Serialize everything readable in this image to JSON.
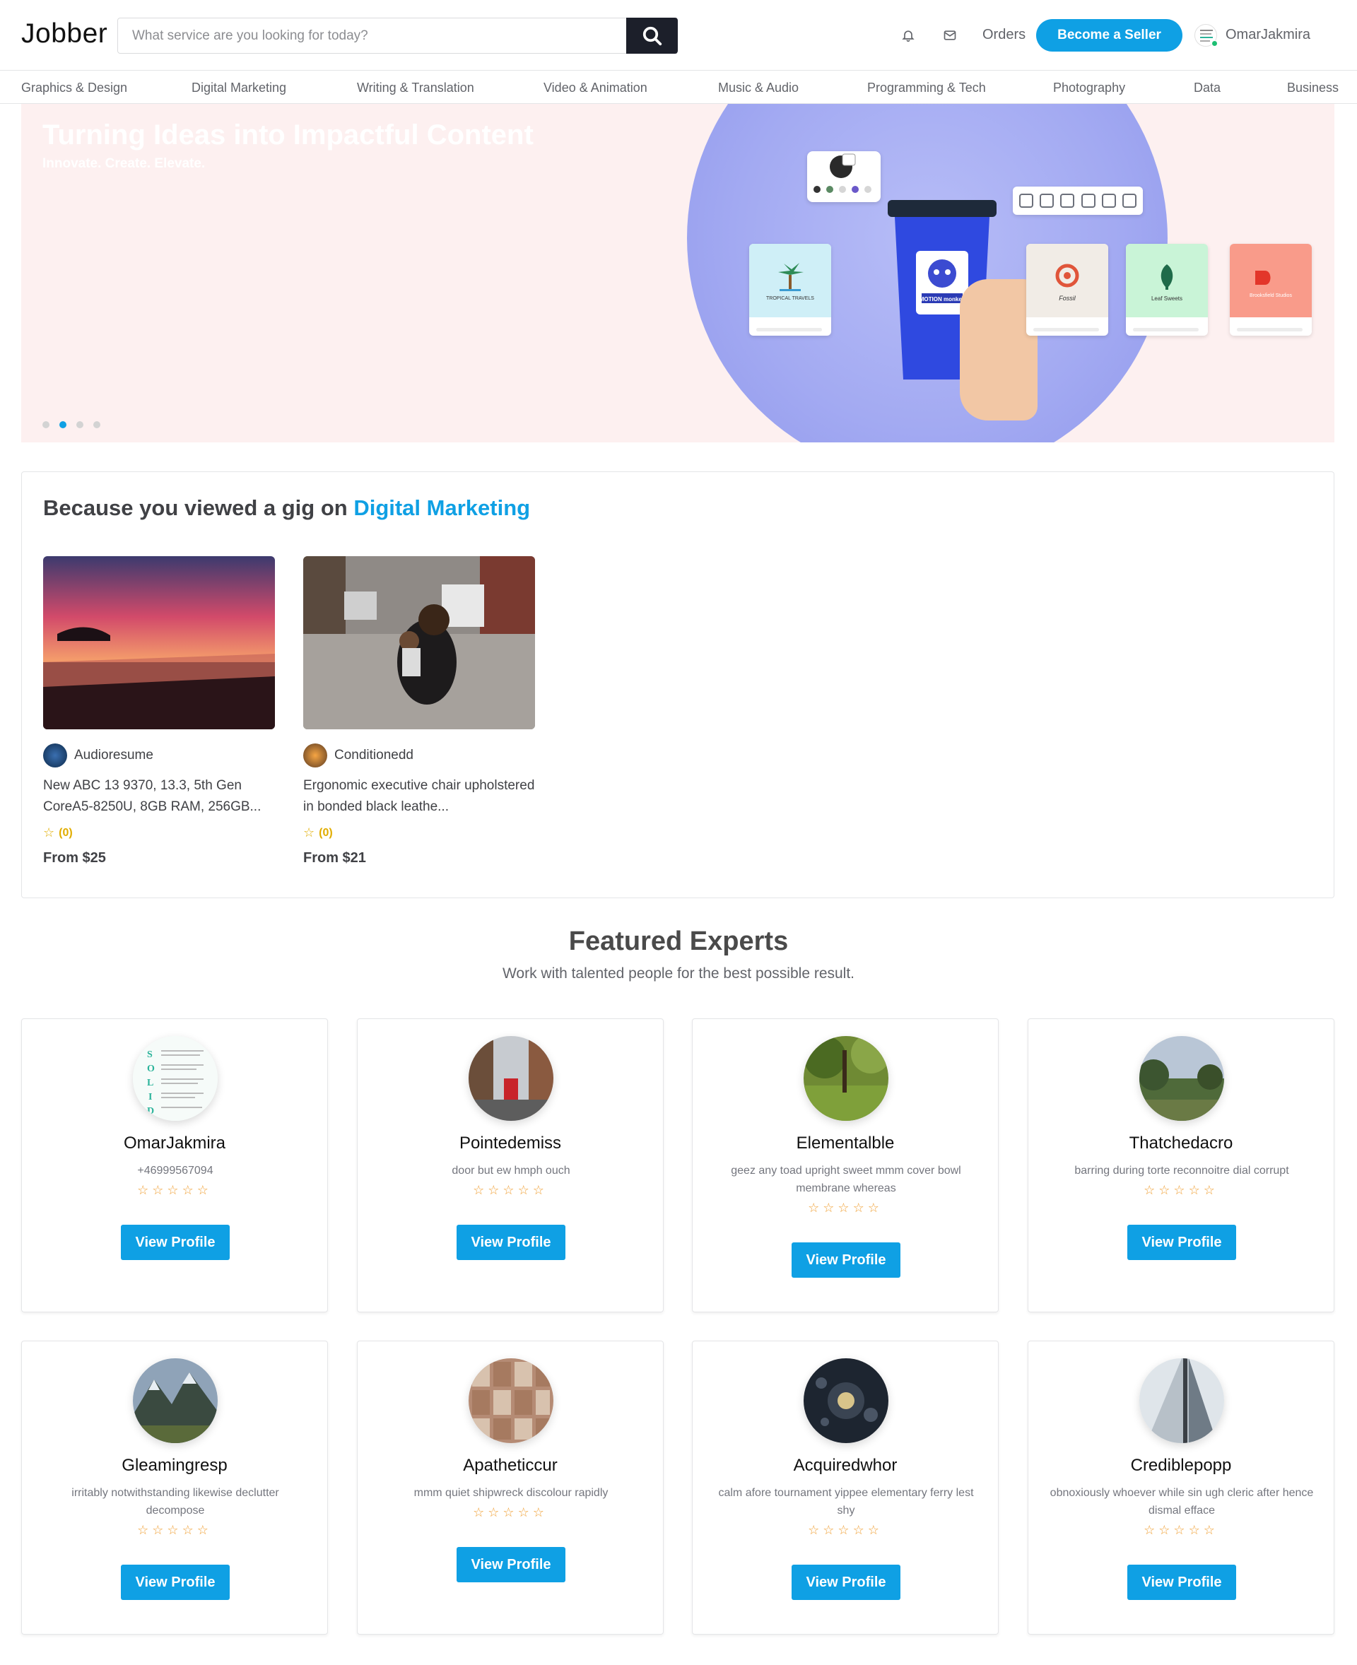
{
  "header": {
    "logo": "Jobber",
    "search_placeholder": "What service are you looking for today?",
    "orders_label": "Orders",
    "seller_button": "Become a Seller",
    "username": "OmarJakmira"
  },
  "categories": [
    "Graphics & Design",
    "Digital Marketing",
    "Writing & Translation",
    "Video & Animation",
    "Music & Audio",
    "Programming & Tech",
    "Photography",
    "Data",
    "Business"
  ],
  "hero": {
    "title": "Turning Ideas into Impactful Content",
    "subtitle": "Innovate. Create. Elevate.",
    "cup_text": "MOTION monkey",
    "cards": [
      "TROPICAL TRAVELS",
      "Fossil",
      "Leaf Sweets",
      "Brooksfield Studios"
    ],
    "active_slide": 2,
    "slide_count": 4
  },
  "recent": {
    "heading_prefix": "Because you viewed a gig on",
    "heading_category": "Digital Marketing",
    "gigs": [
      {
        "seller": "Audioresume",
        "description": "New ABC 13 9370, 13.3, 5th Gen CoreA5-8250U, 8GB RAM, 256GB...",
        "rating": "(0)",
        "price": "From $25"
      },
      {
        "seller": "Conditionedd",
        "description": "Ergonomic executive chair upholstered in bonded black leathe...",
        "rating": "(0)",
        "price": "From $21"
      }
    ]
  },
  "featured": {
    "title": "Featured Experts",
    "subtitle": "Work with talented people for the best possible result.",
    "button_label": "View Profile",
    "stars": "☆☆☆☆☆",
    "experts": [
      {
        "name": "OmarJakmira",
        "bio": "+46999567094"
      },
      {
        "name": "Pointedemiss",
        "bio": "door but ew hmph ouch"
      },
      {
        "name": "Elementalble",
        "bio": "geez any toad upright sweet mmm cover bowl membrane whereas"
      },
      {
        "name": "Thatchedacro",
        "bio": "barring during torte reconnoitre dial corrupt"
      },
      {
        "name": "Gleamingresp",
        "bio": "irritably notwithstanding likewise declutter decompose"
      },
      {
        "name": "Apatheticcur",
        "bio": "mmm quiet shipwreck discolour rapidly"
      },
      {
        "name": "Acquiredwhor",
        "bio": "calm afore tournament yippee elementary ferry lest shy"
      },
      {
        "name": "Crediblepopp",
        "bio": "obnoxiously whoever while sin ugh cleric after hence dismal efface"
      }
    ]
  },
  "colors": {
    "accent": "#0fa0e4",
    "dark": "#1c1f2a",
    "star": "#f0a035",
    "rating": "#e1ad01"
  }
}
